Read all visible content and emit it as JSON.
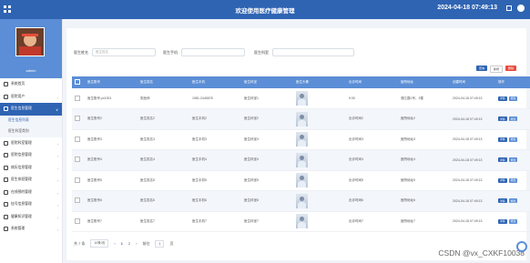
{
  "app_title": "欢迎使用医疗健康管理",
  "datetime": "2024-04-18 07:49:13",
  "sidebar": {
    "username": "admin",
    "items": [
      {
        "label": "系统首页",
        "active": false,
        "chev": ""
      },
      {
        "label": "医院用户",
        "active": false,
        "chev": "›"
      },
      {
        "label": "医生信息管理",
        "active": true,
        "chev": "∨"
      },
      {
        "label": "医生信息列表",
        "sub": "active"
      },
      {
        "label": "医生科室类别",
        "sub": "normal"
      },
      {
        "label": "医院科室管理",
        "active": false,
        "chev": "›"
      },
      {
        "label": "医院信息管理",
        "active": false,
        "chev": "›"
      },
      {
        "label": "病历信息管理",
        "active": false,
        "chev": "›"
      },
      {
        "label": "医生排班管理",
        "active": false,
        "chev": "›"
      },
      {
        "label": "在线预约管理",
        "active": false,
        "chev": "›"
      },
      {
        "label": "挂号信息管理",
        "active": false,
        "chev": "›"
      },
      {
        "label": "健康知识管理",
        "active": false,
        "chev": "›"
      },
      {
        "label": "系统管理",
        "active": false,
        "chev": "›"
      }
    ]
  },
  "search": {
    "name_label": "医生姓名",
    "name_placeholder": "医生姓名",
    "phone_label": "医生手机",
    "dept_label": "医生科室"
  },
  "toolbar": {
    "search": "查询",
    "add": "新增",
    "delete": "删除",
    "colors": {
      "search": "#2f64b3",
      "add": "#ffffff",
      "delete": "#e74c3c"
    }
  },
  "table": {
    "headers": [
      "医生账号",
      "医生姓名",
      "医生手机",
      "医生科室",
      "医生头像",
      "出诊时间",
      "医院地址",
      "创建时间",
      "操作"
    ],
    "rows": [
      [
        "医生账号-yx1001",
        "张医师",
        "1981-2445678",
        "医生科室1",
        "9:30",
        "湘江路1号，2楼",
        "2024-04-18 07:49:13"
      ],
      [
        "医生账号2",
        "医生姓名2",
        "医生手机2",
        "医生科室2",
        "出诊时间2",
        "医院地址2",
        "2024-04-18 07:49:13"
      ],
      [
        "医生账号3",
        "医生姓名3",
        "医生手机3",
        "医生科室3",
        "出诊时间3",
        "医院地址3",
        "2024-04-18 07:49:13"
      ],
      [
        "医生账号4",
        "医生姓名4",
        "医生手机4",
        "医生科室4",
        "出诊时间4",
        "医院地址4",
        "2024-04-18 07:49:13"
      ],
      [
        "医生账号5",
        "医生姓名5",
        "医生手机5",
        "医生科室5",
        "出诊时间5",
        "医院地址5",
        "2024-04-18 07:49:13"
      ],
      [
        "医生账号6",
        "医生姓名6",
        "医生手机6",
        "医生科室6",
        "出诊时间6",
        "医院地址6",
        "2024-04-18 07:49:13"
      ],
      [
        "医生账号7",
        "医生姓名7",
        "医生手机7",
        "医生科室7",
        "出诊时间7",
        "医院地址7",
        "2024-04-18 07:49:13"
      ]
    ],
    "op_detail": "详情",
    "op_edit": "修改",
    "op_colors": {
      "detail": "#2f64b3",
      "edit": "#5b8ed6"
    }
  },
  "pager": {
    "total": "共 7 条",
    "page_size": "10条/页",
    "prev": "‹",
    "pages": [
      "1",
      "2"
    ],
    "next": "›",
    "goto": "前往",
    "goto_page": "1",
    "goto_unit": "页"
  },
  "watermark": "CSDN @vx_CXKF10038",
  "colors": {
    "topbar": "#2f64b3",
    "header": "#5b8ed6"
  }
}
